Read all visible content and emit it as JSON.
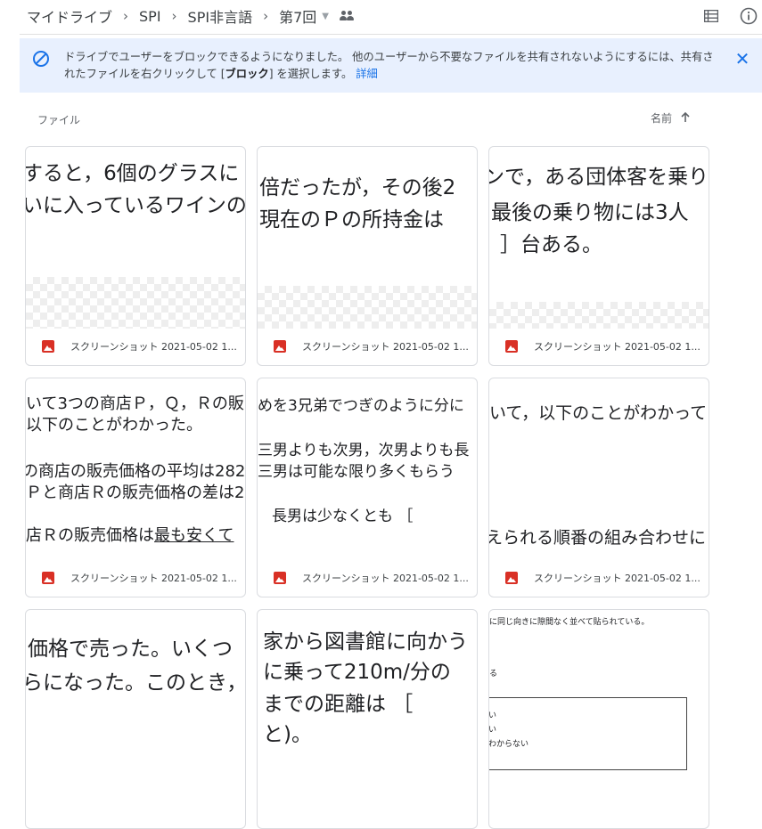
{
  "breadcrumb": {
    "items": [
      "マイドライブ",
      "SPI",
      "SPI非言語",
      "第7回"
    ],
    "separator": "›"
  },
  "header": {
    "icons": [
      "list-view-icon",
      "info-icon"
    ]
  },
  "banner": {
    "text_main": "ドライブでユーザーをブロックできるようになりました。 他のユーザーから不要なファイルを共有されないようにするには、共有されたファイルを右クリックして [",
    "text_bold": "ブロック",
    "text_after": "] を選択します。",
    "link": "詳細",
    "icons": [
      "block-icon",
      "close-icon"
    ]
  },
  "files_section": {
    "label": "ファイル",
    "sort_label": "名前",
    "sort_icon": "arrow-up-icon"
  },
  "file_cards": [
    {
      "name": "スクリーンショット 2021-05-02 1...",
      "preview": [
        "すると，6個のグラスに",
        "いに入っているワインの"
      ]
    },
    {
      "name": "スクリーンショット 2021-05-02 1...",
      "preview": [
        "倍だったが，その後2",
        "現在のＰの所持金は"
      ]
    },
    {
      "name": "スクリーンショット 2021-05-02 1...",
      "preview": [
        "ンで，ある団体客を乗り",
        "最後の乗り物には3人",
        "］台ある。"
      ]
    },
    {
      "name": "スクリーンショット 2021-05-02 1...",
      "preview": [
        "いて3つの商店Ｐ，Ｑ，Ｒの販",
        "以下のことがわかった。",
        "の商店の販売価格の平均は282",
        "Ｐと商店Ｒの販売価格の差は2",
        "店Ｒの販売価格は",
        "最も安くて"
      ]
    },
    {
      "name": "スクリーンショット 2021-05-02 1...",
      "preview": [
        "めを3兄弟でつぎのように分に",
        "三男よりも次男，次男よりも長",
        "三男は可能な限り多くもらう",
        "長男は少なくとも ［"
      ]
    },
    {
      "name": "スクリーンショット 2021-05-02 1...",
      "preview": [
        "いて，以下のことがわかって",
        "えられる順番の組み合わせに"
      ]
    },
    {
      "name": "",
      "preview": [
        "価格で売った。いくつ",
        "らになった。このとき，"
      ]
    },
    {
      "name": "",
      "preview": [
        "家から図書館に向かう",
        "に乗って210m/分の",
        "までの距離は ［",
        "と)。"
      ]
    },
    {
      "name": "",
      "preview": [
        "に同じ向きに隙間なく並べて貼られている。",
        "る",
        "い",
        "い",
        "わからない"
      ]
    }
  ],
  "colors": {
    "accent": "#1a73e8",
    "banner_bg": "#e8f0fe",
    "image_icon": "#d93025"
  }
}
